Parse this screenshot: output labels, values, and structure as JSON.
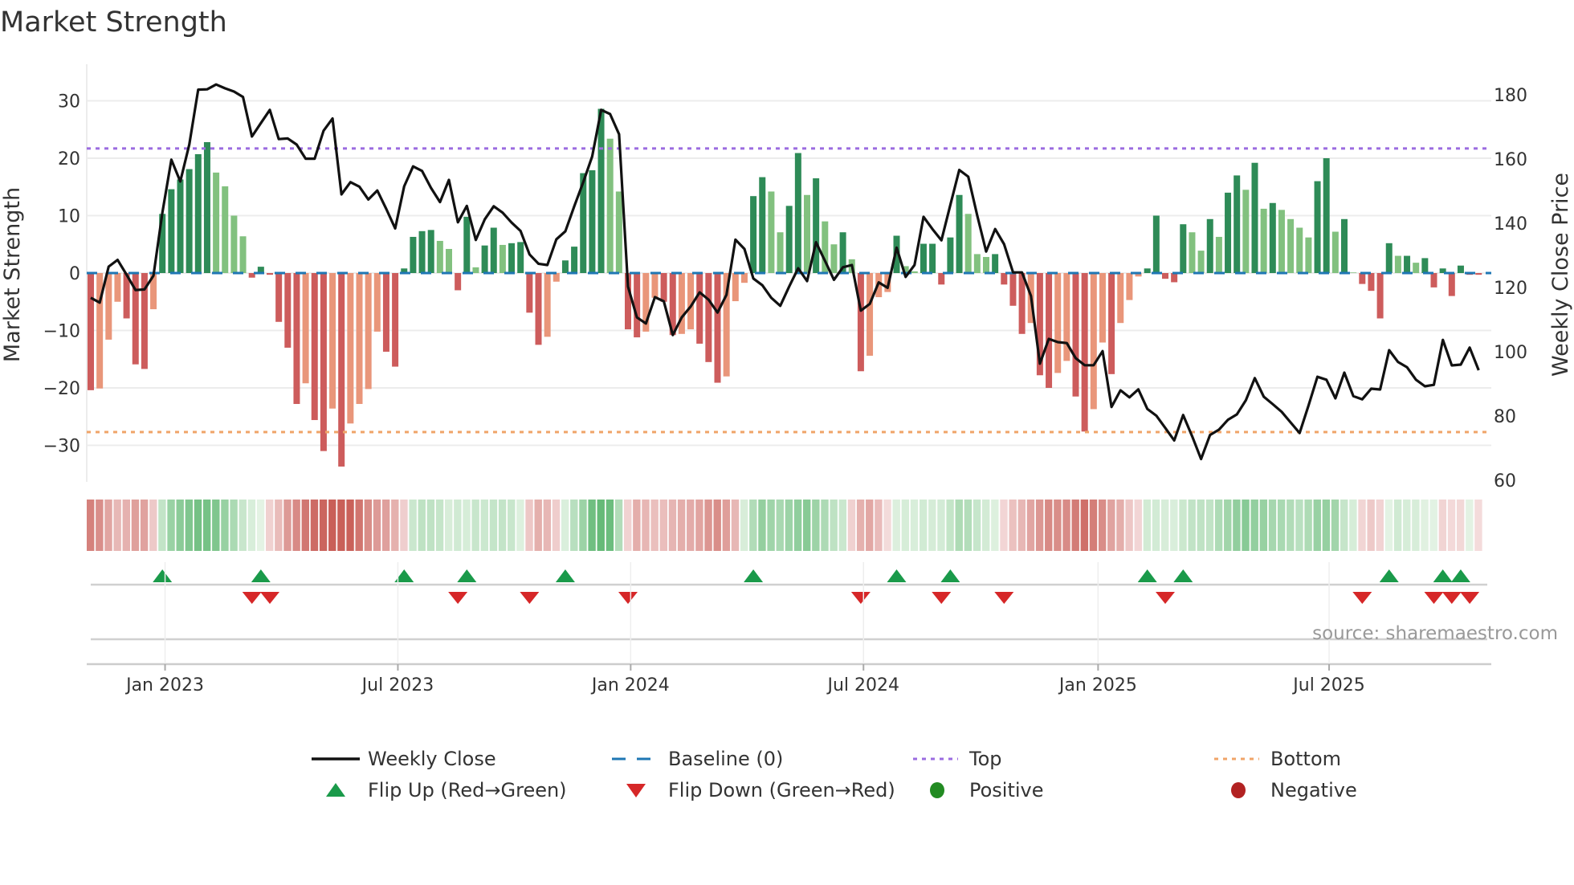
{
  "chart_data": {
    "type": "bar",
    "title": "Market Strength",
    "ylabel": "Market Strength",
    "y2label": "Weekly Close Price",
    "ylim": [
      -37,
      35
    ],
    "y2lim": [
      60,
      185
    ],
    "yticks": [
      "30",
      "20",
      "10",
      "0",
      "−10",
      "−20",
      "−30"
    ],
    "ytick_values": [
      30,
      20,
      10,
      0,
      -10,
      -20,
      -30
    ],
    "y2ticks": [
      "180",
      "160",
      "140",
      "120",
      "100",
      "80",
      "60"
    ],
    "y2tick_values": [
      180,
      160,
      140,
      120,
      100,
      80,
      60
    ],
    "xticks": [
      "Jan 2023",
      "Jul 2023",
      "Jan 2024",
      "Jul 2024",
      "Jan 2025",
      "Jul 2025"
    ],
    "xtick_weeks": [
      8.3,
      34.3,
      60.3,
      86.3,
      112.5,
      138.3
    ],
    "top_level": 21.7,
    "bottom_level": -27.7,
    "baseline": 0,
    "grid": true,
    "strength": [
      -20.4,
      -20.1,
      -11.6,
      -5,
      -7.9,
      -15.9,
      -16.7,
      -6.3,
      10.3,
      14.6,
      16.3,
      18.1,
      20.7,
      22.8,
      17.5,
      15.1,
      10,
      6.4,
      -0.8,
      1.1,
      -0.3,
      -8.5,
      -13,
      -22.8,
      -19.2,
      -25.6,
      -31,
      -23.6,
      -33.7,
      -26.2,
      -22.8,
      -20.2,
      -10.2,
      -13.7,
      -16.3,
      0.8,
      6.3,
      7.3,
      7.5,
      5.6,
      4.2,
      -3,
      9.8,
      1,
      4.8,
      7.9,
      4.9,
      5.2,
      5.4,
      -6.9,
      -12.5,
      -11.1,
      -1.5,
      2.2,
      4.6,
      17.4,
      17.9,
      28.6,
      23.4,
      14.2,
      -9.8,
      -11.2,
      -10.2,
      -4.3,
      -5,
      -10.8,
      -10.6,
      -9.8,
      -12.3,
      -15.5,
      -19.1,
      -18,
      -4.9,
      -1.7,
      13.4,
      16.7,
      14.2,
      7.1,
      11.7,
      20.9,
      13.6,
      16.5,
      9,
      5,
      7.1,
      2.4,
      -17.1,
      -14.4,
      -4.2,
      -3.3,
      6.5,
      1.2,
      0.3,
      5.1,
      5.1,
      -2,
      6.2,
      13.6,
      10.3,
      3.3,
      2.8,
      3.3,
      -2,
      -5.7,
      -10.6,
      -8.7,
      -17.8,
      -20,
      -17.4,
      -15.3,
      -21.5,
      -27.6,
      -23.7,
      -12.1,
      -17.6,
      -8.7,
      -4.7,
      -0.6,
      0.8,
      10,
      -1,
      -1.6,
      8.5,
      7.1,
      3.9,
      9.4,
      6.3,
      14,
      17,
      14.5,
      19.2,
      11.2,
      12.2,
      11,
      9.4,
      7.9,
      6.2,
      16,
      20,
      7.2,
      9.4,
      0.1,
      -1.9,
      -3.1,
      -7.9,
      5.2,
      3,
      3,
      1.8,
      2.6,
      -2.5,
      0.8,
      -4,
      1.3,
      -0.3,
      -0.3
    ],
    "weekly_close": [
      116.8,
      115.3,
      126.5,
      128.6,
      124,
      119.2,
      119.4,
      123.7,
      143.3,
      159.8,
      153,
      164.5,
      181.6,
      181.7,
      183.2,
      182,
      181,
      179.3,
      167,
      171.2,
      175.3,
      166.2,
      166.4,
      164.5,
      160.1,
      160.1,
      168.8,
      172.6,
      149,
      152.8,
      151.4,
      147.4,
      150.2,
      144.5,
      138.4,
      151.5,
      157.7,
      156.3,
      151,
      146.6,
      153.5,
      140.3,
      145.4,
      134.8,
      141.2,
      145.3,
      143.3,
      140.2,
      137.6,
      130.3,
      127.4,
      127,
      135,
      137.5,
      145.3,
      152.8,
      160.8,
      175.3,
      174,
      167.7,
      120.3,
      110.7,
      108.8,
      117,
      115.7,
      105.2,
      110.7,
      114.1,
      118.5,
      116.2,
      112.2,
      117.7,
      134.9,
      132,
      122.8,
      120.7,
      116.8,
      114.3,
      120.3,
      126,
      122,
      134.1,
      128.3,
      122.4,
      126.3,
      127,
      112.8,
      114.9,
      121.6,
      119.9,
      132.4,
      123.3,
      127,
      142,
      138.2,
      134.7,
      145.7,
      156.6,
      154.5,
      142.4,
      131.2,
      138.2,
      133.5,
      124.7,
      124.7,
      117.4,
      96.3,
      104,
      103,
      102.7,
      98,
      95.8,
      95.8,
      100.2,
      82.8,
      88,
      85.8,
      88.3,
      82.2,
      80.1,
      76.3,
      72.4,
      80.3,
      73.7,
      66.6,
      74.1,
      75.75,
      78.8,
      80.5,
      84.9,
      91.8,
      86,
      83.7,
      81.3,
      78,
      74.7,
      83.25,
      92.2,
      91.3,
      85.5,
      93.5,
      86.2,
      85.2,
      88.5,
      88.25,
      100.5,
      96.8,
      95.2,
      91.3,
      89.25,
      89.7,
      103.7,
      95.75,
      96,
      101.3,
      94.25
    ],
    "flip_up_weeks": [
      8,
      19,
      35,
      42,
      53,
      74,
      90,
      96,
      118,
      122,
      145,
      151,
      153
    ],
    "flip_down_weeks": [
      18,
      20,
      41,
      49,
      60,
      86,
      95,
      102,
      120,
      142,
      150,
      152,
      154
    ],
    "legend": {
      "position": "bottom",
      "items": [
        {
          "label": "Weekly Close",
          "kind": "line",
          "color": "#111111"
        },
        {
          "label": "Baseline (0)",
          "kind": "dash",
          "color": "#1f77b4"
        },
        {
          "label": "Top",
          "kind": "dot",
          "color": "#9b6ce0"
        },
        {
          "label": "Bottom",
          "kind": "dot",
          "color": "#f0a468"
        },
        {
          "label": "Flip Up (Red→Green)",
          "kind": "tri-up",
          "color": "#1a9a4a"
        },
        {
          "label": "Flip Down (Green→Red)",
          "kind": "tri-down",
          "color": "#d62728"
        },
        {
          "label": "Positive",
          "kind": "circle",
          "color": "#228b22"
        },
        {
          "label": "Negative",
          "kind": "circle",
          "color": "#b22222"
        }
      ]
    },
    "colors": {
      "pos_strong": "#2e8b57",
      "pos_weak": "#82c17f",
      "neg_strong": "#cd5c5c",
      "neg_weak": "#e9967a",
      "close": "#111111",
      "baseline": "#1f77b4",
      "top": "#9b6ce0",
      "bottom": "#f0a468"
    },
    "source": "source: sharemaestro.com"
  }
}
